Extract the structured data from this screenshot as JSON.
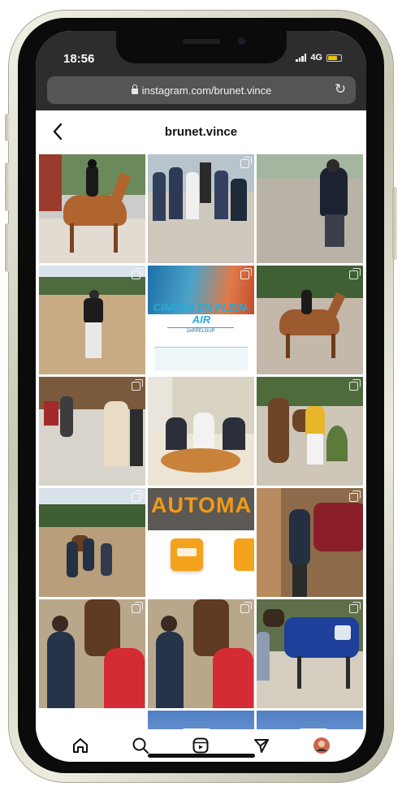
{
  "status_bar": {
    "time": "18:56",
    "network": "4G",
    "battery_color": "#f2c200"
  },
  "browser": {
    "url": "instagram.com/brunet.vince",
    "lock_icon": "lock-icon",
    "reload_icon": "reload-icon"
  },
  "profile_header": {
    "back_icon": "chevron-left-icon",
    "username": "brunet.vince"
  },
  "grid": {
    "posts": [
      {
        "description": "rider-on-bay-horse"
      },
      {
        "description": "group-photo-outdoors"
      },
      {
        "description": "person-on-sand-arena"
      },
      {
        "description": "person-back-view-arena"
      },
      {
        "description": "cinema-poster"
      },
      {
        "description": "rider-on-horse-arena"
      },
      {
        "description": "people-in-stable"
      },
      {
        "description": "meeting-table"
      },
      {
        "description": "woman-with-horse"
      },
      {
        "description": "group-with-horse"
      },
      {
        "description": "automatic-sign"
      },
      {
        "description": "horse-with-blanket"
      },
      {
        "description": "vet-with-horse-1"
      },
      {
        "description": "vet-with-horse-2"
      },
      {
        "description": "horse-blue-blanket"
      },
      {
        "description": "partial-sky-1"
      },
      {
        "description": "partial-sky-2"
      }
    ],
    "cinema_text": "CINEMA EN PLEIN-AIR",
    "cinema_sub": "JAPPELOUP",
    "auto_text": "AUTOMA"
  },
  "bottom_nav": {
    "items": [
      "home-icon",
      "search-icon",
      "reels-icon",
      "send-icon",
      "profile-avatar"
    ]
  }
}
